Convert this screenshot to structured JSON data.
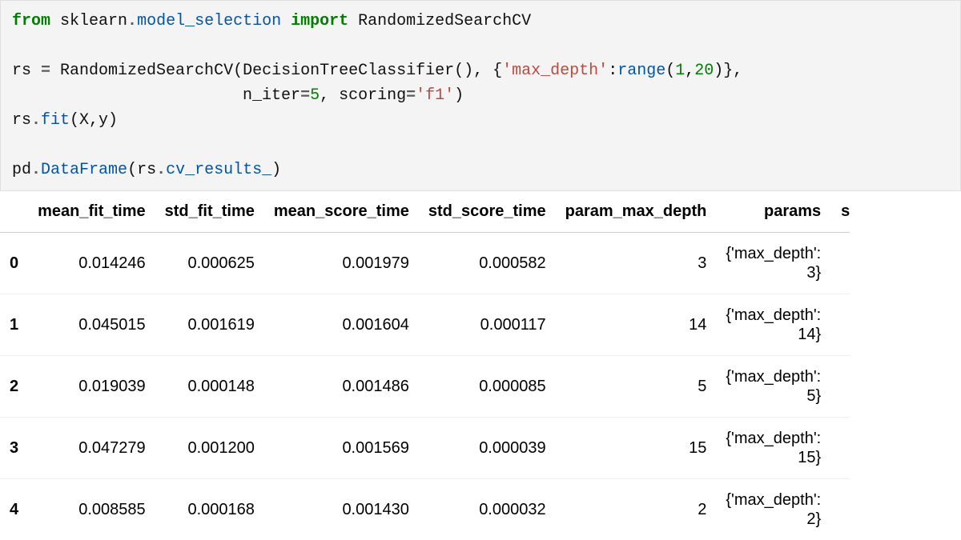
{
  "code": {
    "t_from": "from",
    "t_sklearn": "sklearn",
    "t_dot1": ".",
    "t_model_selection": "model_selection",
    "t_import": "import",
    "t_rscv": "RandomizedSearchCV",
    "t_rs": "rs",
    "t_eq": " = ",
    "t_rscv2": "RandomizedSearchCV",
    "t_open1": "(",
    "t_dtc": "DecisionTreeClassifier",
    "t_call1": "(), {",
    "t_key": "'max_depth'",
    "t_colon": ":",
    "t_range": "range",
    "t_open2": "(",
    "t_one": "1",
    "t_comma1": ",",
    "t_twenty": "20",
    "t_close1": ")},",
    "t_indent": "                        ",
    "t_niter": "n_iter",
    "t_eq2": "=",
    "t_five": "5",
    "t_comma2": ", scoring",
    "t_eq3": "=",
    "t_f1": "'f1'",
    "t_close2": ")",
    "t_rs2": "rs",
    "t_dot2": ".",
    "t_fit": "fit",
    "t_fitargs": "(X,y)",
    "t_pd": "pd",
    "t_dot3": ".",
    "t_df": "DataFrame",
    "t_open3": "(rs",
    "t_dot4": ".",
    "t_cvr": "cv_results_",
    "t_close3": ")"
  },
  "chart_data": {
    "type": "table",
    "columns": [
      "mean_fit_time",
      "std_fit_time",
      "mean_score_time",
      "std_score_time",
      "param_max_depth",
      "params",
      "s"
    ],
    "index": [
      "0",
      "1",
      "2",
      "3",
      "4"
    ],
    "rows": [
      {
        "mean_fit_time": "0.014246",
        "std_fit_time": "0.000625",
        "mean_score_time": "0.001979",
        "std_score_time": "0.000582",
        "param_max_depth": "3",
        "params_l1": "{'max_depth':",
        "params_l2": "3}"
      },
      {
        "mean_fit_time": "0.045015",
        "std_fit_time": "0.001619",
        "mean_score_time": "0.001604",
        "std_score_time": "0.000117",
        "param_max_depth": "14",
        "params_l1": "{'max_depth':",
        "params_l2": "14}"
      },
      {
        "mean_fit_time": "0.019039",
        "std_fit_time": "0.000148",
        "mean_score_time": "0.001486",
        "std_score_time": "0.000085",
        "param_max_depth": "5",
        "params_l1": "{'max_depth':",
        "params_l2": "5}"
      },
      {
        "mean_fit_time": "0.047279",
        "std_fit_time": "0.001200",
        "mean_score_time": "0.001569",
        "std_score_time": "0.000039",
        "param_max_depth": "15",
        "params_l1": "{'max_depth':",
        "params_l2": "15}"
      },
      {
        "mean_fit_time": "0.008585",
        "std_fit_time": "0.000168",
        "mean_score_time": "0.001430",
        "std_score_time": "0.000032",
        "param_max_depth": "2",
        "params_l1": "{'max_depth':",
        "params_l2": "2}"
      }
    ]
  }
}
